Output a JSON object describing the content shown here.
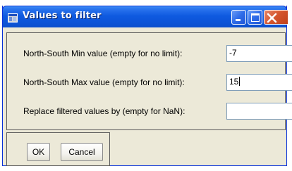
{
  "window": {
    "title": "Values to filter"
  },
  "fields": [
    {
      "label": "North-South Min value (empty for no limit):",
      "value": "-7"
    },
    {
      "label": "North-South Max value (empty for no limit):",
      "value": "15"
    },
    {
      "label": "Replace filtered values by (empty for NaN):",
      "value": ""
    }
  ],
  "buttons": {
    "ok_label": "OK",
    "cancel_label": "Cancel"
  },
  "colors": {
    "titlebar_blue": "#0c54d8",
    "window_face": "#ece9d8",
    "close_red": "#d4542c"
  },
  "icons": {
    "app": "app-window-icon",
    "minimize": "minimize-icon",
    "maximize": "maximize-icon",
    "close": "close-icon"
  }
}
